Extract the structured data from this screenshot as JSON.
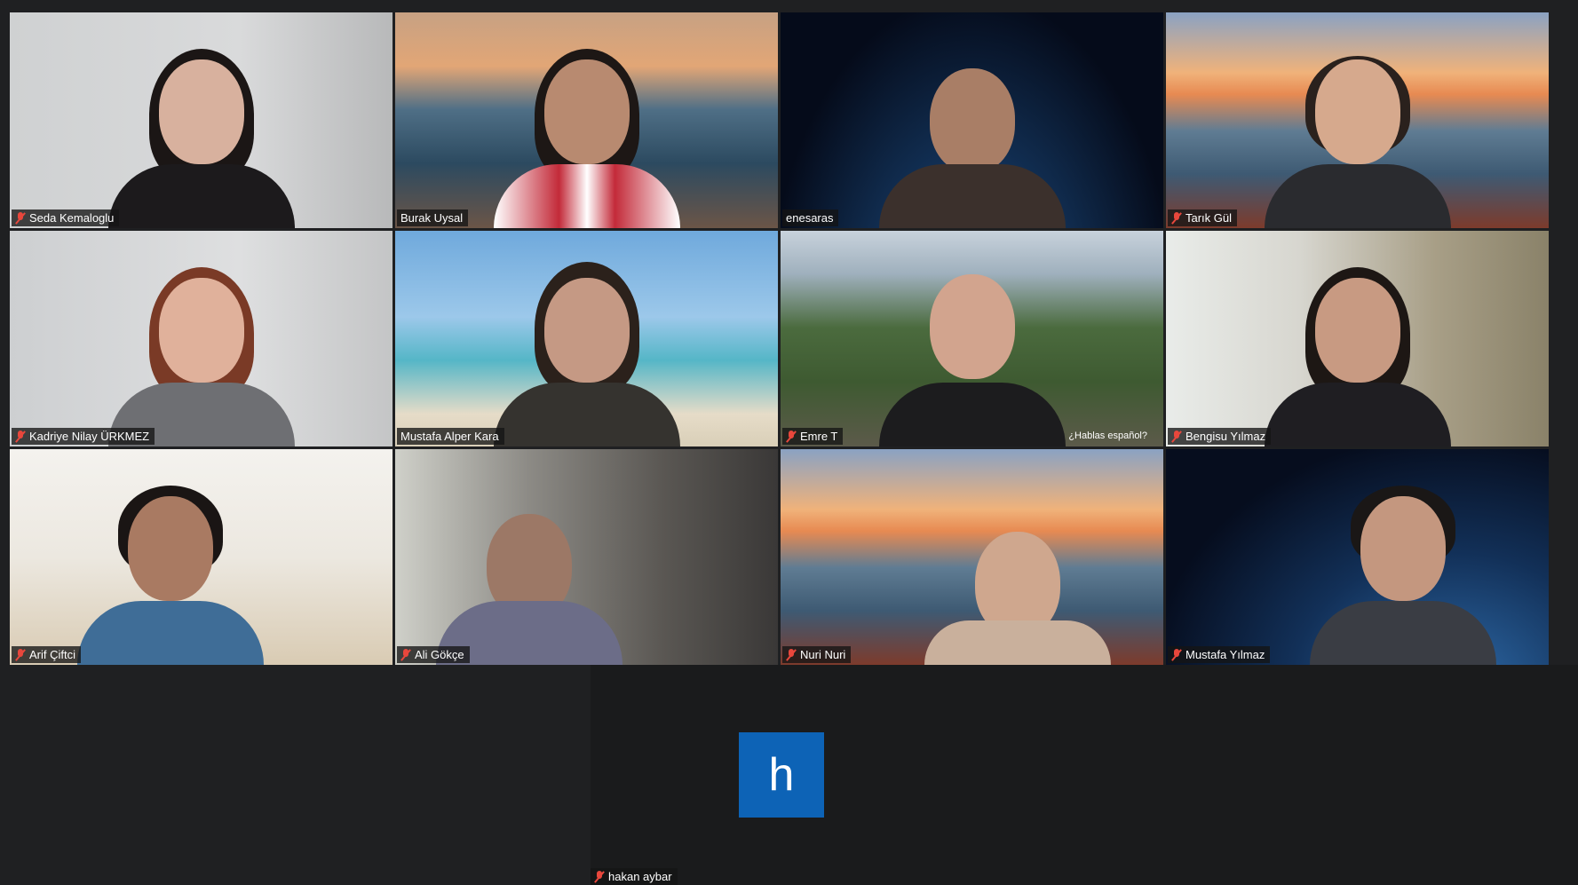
{
  "participants": [
    {
      "name": "Seda Kemaloglu",
      "muted": true
    },
    {
      "name": "Burak Uysal",
      "muted": false
    },
    {
      "name": "enesaras",
      "muted": false
    },
    {
      "name": "Tarık Gül",
      "muted": true
    },
    {
      "name": "Kadriye Nilay ÜRKMEZ",
      "muted": true
    },
    {
      "name": "Mustafa Alper Kara",
      "muted": false,
      "active_speaker": true
    },
    {
      "name": "Emre T",
      "muted": true
    },
    {
      "name": "Bengisu Yılmaz",
      "muted": true
    },
    {
      "name": "Arif Çiftci",
      "muted": true
    },
    {
      "name": "Ali Gökçe",
      "muted": true
    },
    {
      "name": "Nuri Nuri",
      "muted": true
    },
    {
      "name": "Mustafa Yılmaz",
      "muted": true
    }
  ],
  "camera_off_participant": {
    "name": "hakan aybar",
    "avatar_letter": "h",
    "muted": true
  },
  "background_text": "¿Hablas español?",
  "colors": {
    "background": "#1f2022",
    "active_border": "#d7e24a",
    "avatar": "#0d63b6",
    "mute": "#e8473c"
  }
}
